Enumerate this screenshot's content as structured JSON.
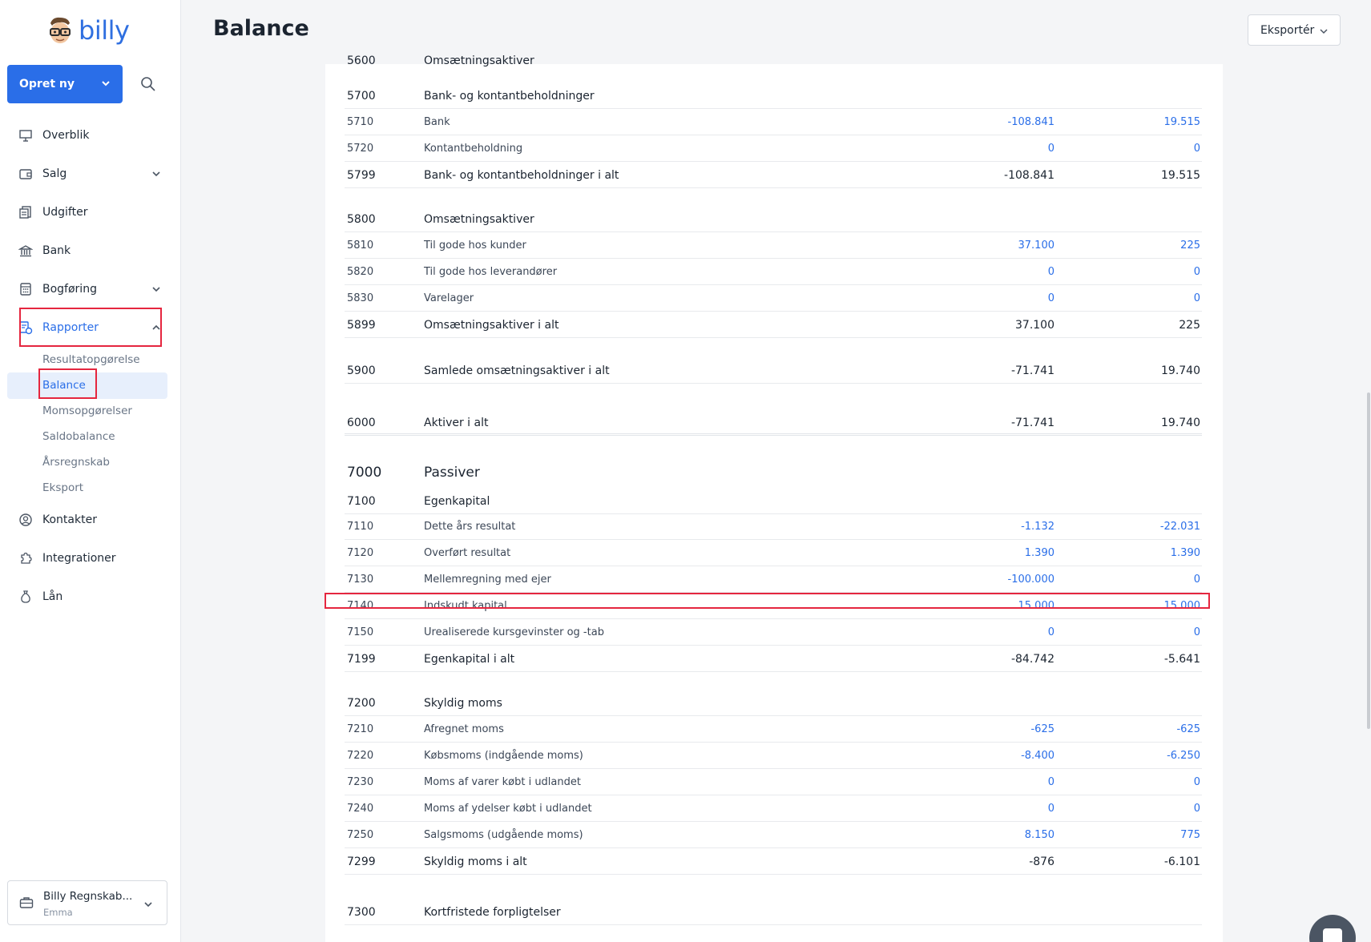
{
  "app": {
    "logo_text": "billy"
  },
  "sidebar": {
    "create_label": "Opret ny",
    "items": [
      {
        "label": "Overblik",
        "icon": "presentation-icon"
      },
      {
        "label": "Salg",
        "icon": "wallet-icon"
      },
      {
        "label": "Udgifter",
        "icon": "receipt-icon"
      },
      {
        "label": "Bank",
        "icon": "bank-icon"
      },
      {
        "label": "Bogføring",
        "icon": "calculator-icon"
      },
      {
        "label": "Rapporter",
        "icon": "report-icon"
      },
      {
        "label": "Kontakter",
        "icon": "user-circle-icon"
      },
      {
        "label": "Integrationer",
        "icon": "puzzle-icon"
      },
      {
        "label": "Lån",
        "icon": "money-bag-icon"
      }
    ],
    "sub_items": [
      "Resultatopgørelse",
      "Balance",
      "Momsopgørelser",
      "Saldobalance",
      "Årsregnskab",
      "Eksport"
    ],
    "org": {
      "name": "Billy Regnskab...",
      "user": "Emma"
    }
  },
  "header": {
    "title": "Balance",
    "export_label": "Eksportér"
  },
  "colors": {
    "accent": "#2a6ee8",
    "highlight": "#e5263f"
  },
  "rows": [
    {
      "code": "5600",
      "name": "Omsætningsaktiver",
      "v1": "",
      "v2": ""
    },
    {
      "code": "5700",
      "name": "Bank- og kontantbeholdninger",
      "v1": "",
      "v2": ""
    },
    {
      "code": "5710",
      "name": "Bank",
      "v1": "-108.841",
      "v2": "19.515"
    },
    {
      "code": "5720",
      "name": "Kontantbeholdning",
      "v1": "0",
      "v2": "0"
    },
    {
      "code": "5799",
      "name": "Bank- og kontantbeholdninger i alt",
      "v1": "-108.841",
      "v2": "19.515"
    },
    {
      "code": "5800",
      "name": "Omsætningsaktiver",
      "v1": "",
      "v2": ""
    },
    {
      "code": "5810",
      "name": "Til gode hos kunder",
      "v1": "37.100",
      "v2": "225"
    },
    {
      "code": "5820",
      "name": "Til gode hos leverandører",
      "v1": "0",
      "v2": "0"
    },
    {
      "code": "5830",
      "name": "Varelager",
      "v1": "0",
      "v2": "0"
    },
    {
      "code": "5899",
      "name": "Omsætningsaktiver i alt",
      "v1": "37.100",
      "v2": "225"
    },
    {
      "code": "5900",
      "name": "Samlede omsætningsaktiver i alt",
      "v1": "-71.741",
      "v2": "19.740"
    },
    {
      "code": "6000",
      "name": "Aktiver i alt",
      "v1": "-71.741",
      "v2": "19.740"
    },
    {
      "code": "7000",
      "name": "Passiver",
      "v1": "",
      "v2": ""
    },
    {
      "code": "7100",
      "name": "Egenkapital",
      "v1": "",
      "v2": ""
    },
    {
      "code": "7110",
      "name": "Dette års resultat",
      "v1": "-1.132",
      "v2": "-22.031"
    },
    {
      "code": "7120",
      "name": "Overført resultat",
      "v1": "1.390",
      "v2": "1.390"
    },
    {
      "code": "7130",
      "name": "Mellemregning med ejer",
      "v1": "-100.000",
      "v2": "0"
    },
    {
      "code": "7140",
      "name": "Indskudt kapital",
      "v1": "15.000",
      "v2": "15.000"
    },
    {
      "code": "7150",
      "name": "Urealiserede kursgevinster og -tab",
      "v1": "0",
      "v2": "0"
    },
    {
      "code": "7199",
      "name": "Egenkapital i alt",
      "v1": "-84.742",
      "v2": "-5.641"
    },
    {
      "code": "7200",
      "name": "Skyldig moms",
      "v1": "",
      "v2": ""
    },
    {
      "code": "7210",
      "name": "Afregnet moms",
      "v1": "-625",
      "v2": "-625"
    },
    {
      "code": "7220",
      "name": "Købsmoms (indgående moms)",
      "v1": "-8.400",
      "v2": "-6.250"
    },
    {
      "code": "7230",
      "name": "Moms af varer købt i udlandet",
      "v1": "0",
      "v2": "0"
    },
    {
      "code": "7240",
      "name": "Moms af ydelser købt i udlandet",
      "v1": "0",
      "v2": "0"
    },
    {
      "code": "7250",
      "name": "Salgsmoms (udgående moms)",
      "v1": "8.150",
      "v2": "775"
    },
    {
      "code": "7299",
      "name": "Skyldig moms i alt",
      "v1": "-876",
      "v2": "-6.101"
    },
    {
      "code": "7300",
      "name": "Kortfristede forpligtelser",
      "v1": "",
      "v2": ""
    }
  ]
}
